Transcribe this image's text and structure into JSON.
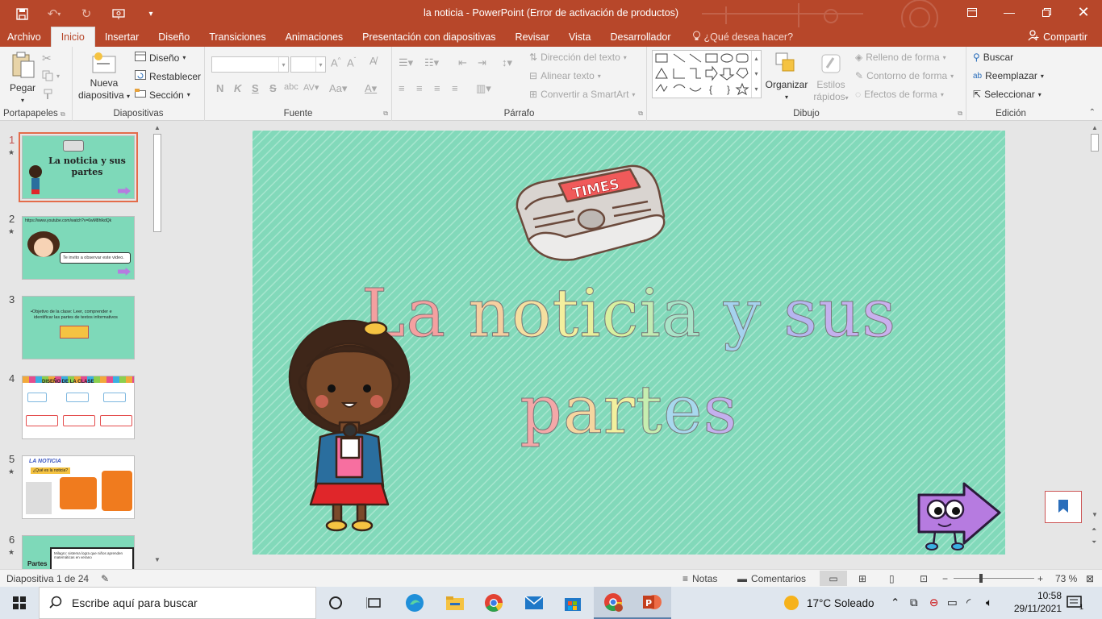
{
  "titlebar": {
    "title": "la noticia - PowerPoint (Error de activación de productos)"
  },
  "tabs": [
    "Archivo",
    "Inicio",
    "Insertar",
    "Diseño",
    "Transiciones",
    "Animaciones",
    "Presentación con diapositivas",
    "Revisar",
    "Vista",
    "Desarrollador"
  ],
  "tellme": "¿Qué desea hacer?",
  "share": "Compartir",
  "ribbon": {
    "portapapeles": {
      "pegar": "Pegar",
      "label": "Portapapeles"
    },
    "diapositivas": {
      "nueva": "Nueva",
      "nueva2": "diapositiva",
      "diseno": "Diseño",
      "restablecer": "Restablecer",
      "seccion": "Sección",
      "label": "Diapositivas"
    },
    "fuente": {
      "label": "Fuente",
      "n": "N",
      "k": "K",
      "s": "S",
      "aa": "Aa"
    },
    "parrafo": {
      "direccion": "Dirección del texto",
      "alinear": "Alinear texto",
      "convertir": "Convertir a SmartArt",
      "label": "Párrafo"
    },
    "dibujo": {
      "organizar": "Organizar",
      "estilos1": "Estilos",
      "estilos2": "rápidos",
      "relleno": "Relleno de forma",
      "contorno": "Contorno de forma",
      "efectos": "Efectos de forma",
      "label": "Dibujo"
    },
    "edicion": {
      "buscar": "Buscar",
      "reemplazar": "Reemplazar",
      "seleccionar": "Seleccionar",
      "label": "Edición"
    }
  },
  "thumbnails": [
    {
      "num": "1",
      "star": "★",
      "title1": "La noticia y sus",
      "title2": "partes"
    },
    {
      "num": "2",
      "star": "★",
      "url": "https://www.youtube.com/watch?v=6wM8hlkdQk",
      "bubble": "Te invito a observar este video."
    },
    {
      "num": "3",
      "star": "",
      "text1": "•Objetivo de la clase: Leer, comprender e",
      "text2": "identificar las partes de textos informativos"
    },
    {
      "num": "4",
      "star": "",
      "text": "DISEÑO DE LA CLASE"
    },
    {
      "num": "5",
      "star": "★",
      "text": "LA NOTICIA",
      "sub": "¿Qué es la noticia?"
    },
    {
      "num": "6",
      "star": "★",
      "text": "Partes",
      "headline": "Milagro: sistema logra que niños aprenden matemáticas en verano"
    }
  ],
  "slide": {
    "newspaper_label": "TIMES",
    "title_line1": [
      "L",
      "a",
      " ",
      "n",
      "o",
      "t",
      "i",
      "c",
      "i",
      "a",
      " ",
      "y",
      " ",
      "s",
      "u",
      "s"
    ],
    "title_line2": [
      "p",
      "a",
      "r",
      "t",
      "e",
      "s"
    ],
    "colors1": [
      "#f4a0a0",
      "#f4a0a0",
      "",
      "#f5cfa0",
      "#f5dfa0",
      "#f3ef9e",
      "#e8f09c",
      "#d8f0a0",
      "#c2ecb4",
      "#a8e4c8",
      "",
      "#a5d2ee",
      "",
      "#b6b6f0",
      "#c4b0ee",
      "#c9b0ee"
    ],
    "colors2": [
      "#f4a8a8",
      "#f5d6a0",
      "#f3f09e",
      "#c6eeb0",
      "#a8d8ee",
      "#c4b0ee"
    ]
  },
  "status": {
    "slide_info": "Diapositiva 1 de 24",
    "notas": "Notas",
    "comentarios": "Comentarios",
    "zoom": "73 %"
  },
  "taskbar": {
    "search": "Escribe aquí para buscar",
    "weather": "17°C  Soleado",
    "time": "10:58",
    "date": "29/11/2021",
    "notif_count": "1"
  },
  "colors": {
    "accent": "#b7472a",
    "ribbon": "#f3f3f3",
    "slide_bg": "#7fd8b8"
  }
}
